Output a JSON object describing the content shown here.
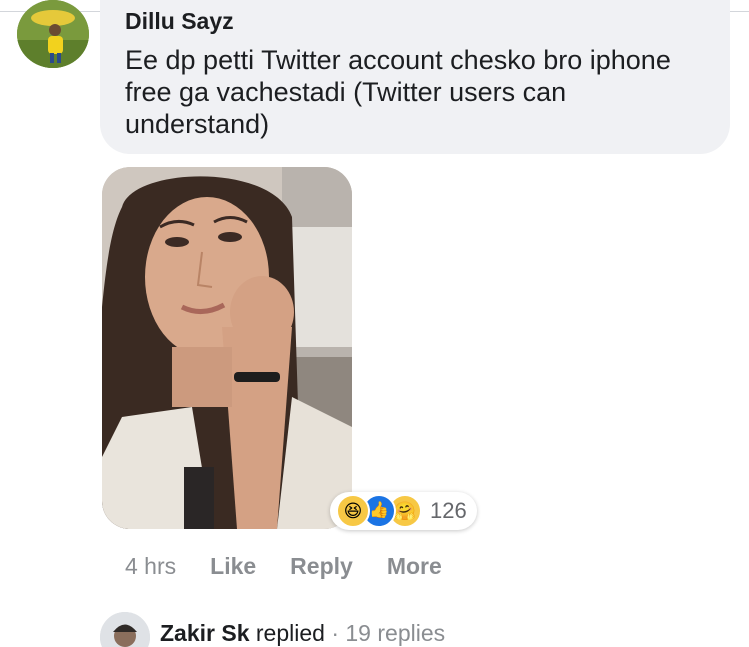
{
  "comment": {
    "author": "Dillu Sayz",
    "text": "Ee dp petti Twitter account chesko bro iphone free ga vachestadi (Twitter users can understand)",
    "timestamp": "4 hrs",
    "actions": {
      "like": "Like",
      "reply": "Reply",
      "more": "More"
    },
    "reactions": {
      "icons": [
        "haha-icon",
        "like-icon",
        "care-icon"
      ],
      "count": "126"
    }
  },
  "reply_preview": {
    "author": "Zakir Sk",
    "verb": "replied",
    "separator": "·",
    "count_text": "19 replies"
  },
  "colors": {
    "bubble": "#f0f1f4",
    "text": "#1c1e21",
    "muted": "#8a8d91",
    "like_blue": "#1b74e4",
    "emoji_yellow": "#f7c845"
  }
}
